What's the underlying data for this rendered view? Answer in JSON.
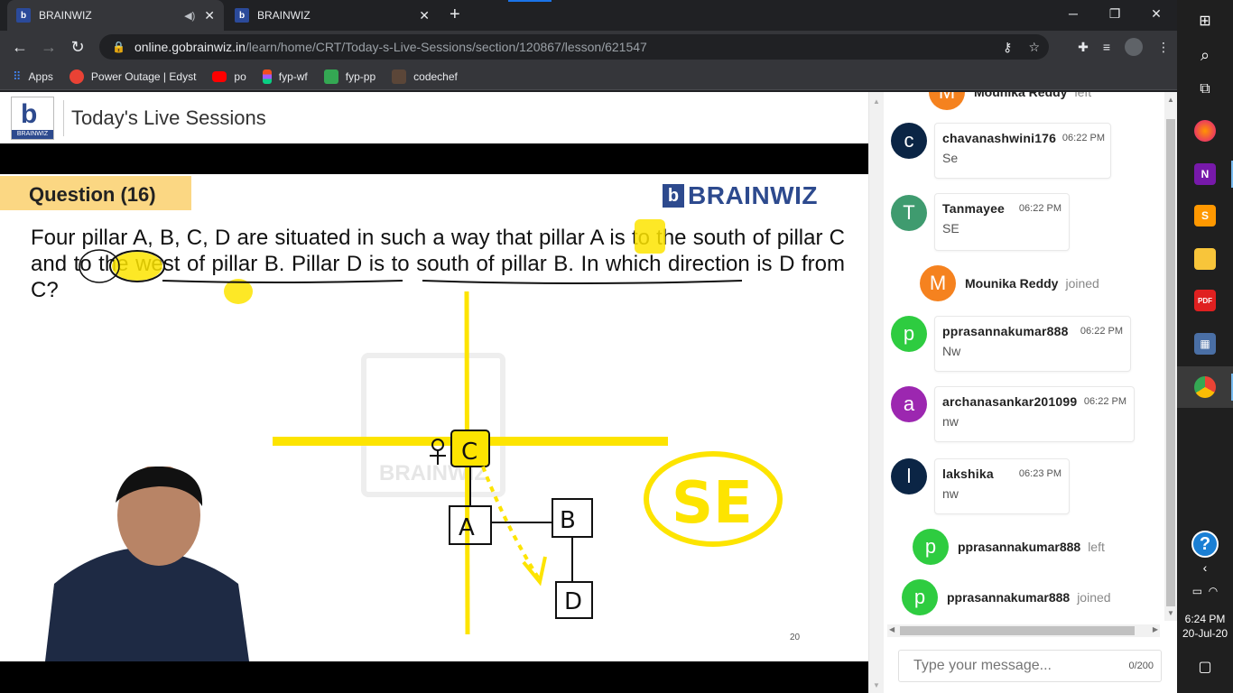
{
  "tabs": [
    {
      "title": "BRAINWIZ",
      "active": true
    },
    {
      "title": "BRAINWIZ",
      "active": false
    }
  ],
  "address": {
    "host": "online.gobrainwiz.in",
    "path": "/learn/home/CRT/Today-s-Live-Sessions/section/120867/lesson/621547"
  },
  "bookmarks": [
    {
      "label": "Apps",
      "color": "#4285f4"
    },
    {
      "label": "Power Outage | Edyst",
      "color": "#e94235"
    },
    {
      "label": "po",
      "color": "#ff0000"
    },
    {
      "label": "fyp-wf",
      "color": "#a259ff"
    },
    {
      "label": "fyp-pp",
      "color": "#34a853"
    },
    {
      "label": "codechef",
      "color": "#5b4638"
    }
  ],
  "page": {
    "title": "Today's Live Sessions",
    "logo_label": "BRAINWIZ"
  },
  "slide": {
    "question_label": "Question (16)",
    "brand": "BRAINWIZ",
    "question_text": "Four pillar A, B, C, D are situated in such a way that pillar A is to the south of pillar C and to the west of pillar B. Pillar D is to south of pillar B. In which direction is D from C?",
    "slide_number": "20",
    "answer_annotation": "SE",
    "watermark": "BRAINWIZ",
    "pillars": {
      "a": "A",
      "b": "B",
      "c": "C",
      "d": "D"
    }
  },
  "chat": {
    "messages": [
      {
        "type": "event",
        "initial": "M",
        "name": "Mounika Reddy",
        "action": "left",
        "color": "#f5821f"
      },
      {
        "type": "msg",
        "initial": "c",
        "name": "chavanashwini176",
        "time": "06:22 PM",
        "text": "Se",
        "color": "#0b2545"
      },
      {
        "type": "msg",
        "initial": "T",
        "name": "Tanmayee",
        "time": "06:22 PM",
        "text": "SE",
        "color": "#3f9b6f"
      },
      {
        "type": "event",
        "initial": "M",
        "name": "Mounika Reddy",
        "action": "joined",
        "color": "#f5821f"
      },
      {
        "type": "msg",
        "initial": "p",
        "name": "pprasannakumar888",
        "time": "06:22 PM",
        "text": "Nw",
        "color": "#2ecc40"
      },
      {
        "type": "msg",
        "initial": "a",
        "name": "archanasankar201099",
        "time": "06:22 PM",
        "text": "nw",
        "color": "#9c27b0"
      },
      {
        "type": "msg",
        "initial": "l",
        "name": "lakshika",
        "time": "06:23 PM",
        "text": "nw",
        "color": "#0b2545"
      },
      {
        "type": "event",
        "initial": "p",
        "name": "pprasannakumar888",
        "action": "left",
        "color": "#2ecc40"
      },
      {
        "type": "event",
        "initial": "p",
        "name": "pprasannakumar888",
        "action": "joined",
        "color": "#2ecc40"
      }
    ],
    "input_placeholder": "Type your message...",
    "char_count": "0/200"
  },
  "taskbar": {
    "time": "6:24 PM",
    "date": "20-Jul-20"
  }
}
